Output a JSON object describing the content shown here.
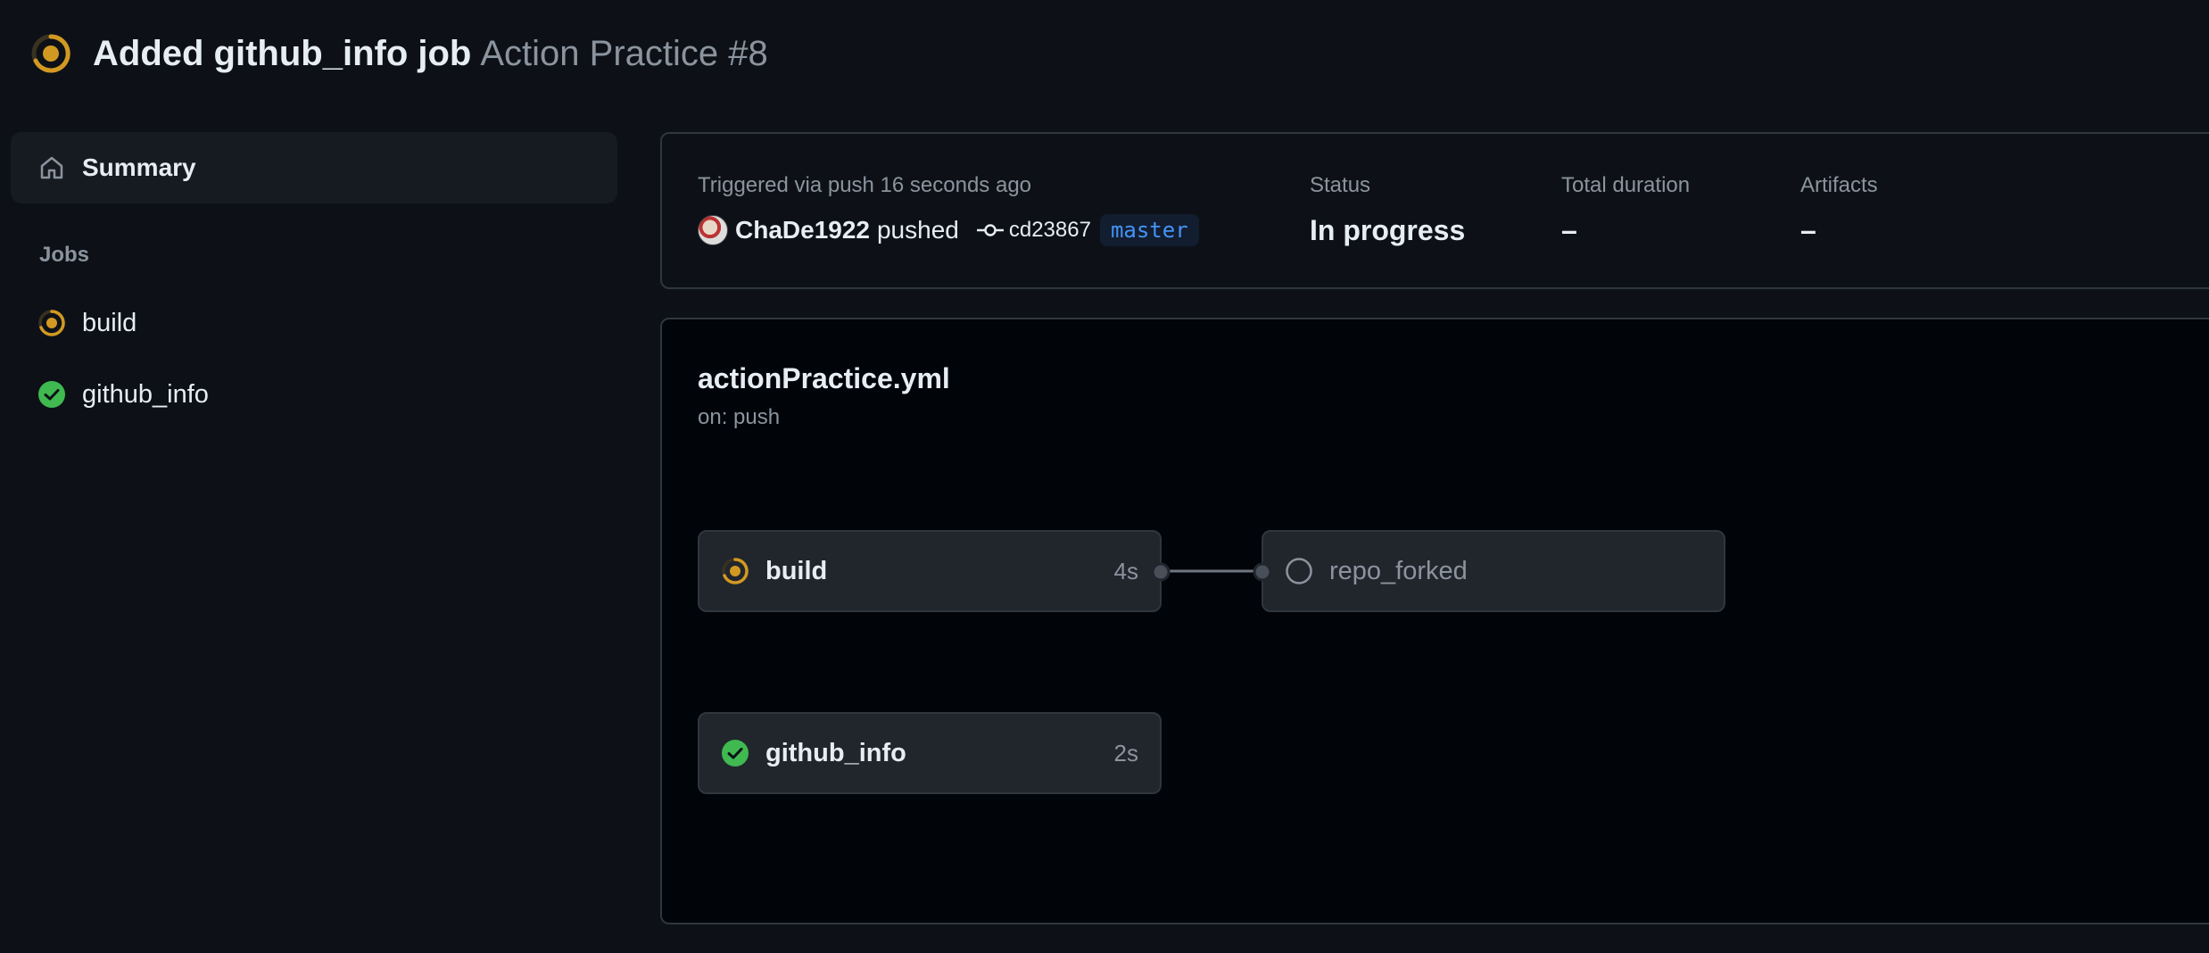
{
  "header": {
    "title": "Added github_info job",
    "subtitle": "Action Practice #8"
  },
  "sidebar": {
    "summary_label": "Summary",
    "jobs_heading": "Jobs",
    "jobs": [
      {
        "label": "build",
        "status": "in_progress"
      },
      {
        "label": "github_info",
        "status": "success"
      }
    ]
  },
  "summary": {
    "trigger_text": "Triggered via push 16 seconds ago",
    "user": "ChaDe1922",
    "action": "pushed",
    "commit": "cd23867",
    "branch": "master",
    "status_label": "Status",
    "status_value": "In progress",
    "duration_label": "Total duration",
    "duration_value": "–",
    "artifacts_label": "Artifacts",
    "artifacts_value": "–"
  },
  "workflow": {
    "filename": "actionPractice.yml",
    "trigger": "on: push",
    "nodes": [
      {
        "label": "build",
        "time": "4s",
        "status": "in_progress"
      },
      {
        "label": "github_info",
        "time": "2s",
        "status": "success"
      },
      {
        "label": "repo_forked",
        "time": "",
        "status": "pending"
      }
    ]
  },
  "colors": {
    "in_progress": "#d29922",
    "success": "#3fb950",
    "pending": "#8b949e",
    "link": "#4493f8"
  }
}
